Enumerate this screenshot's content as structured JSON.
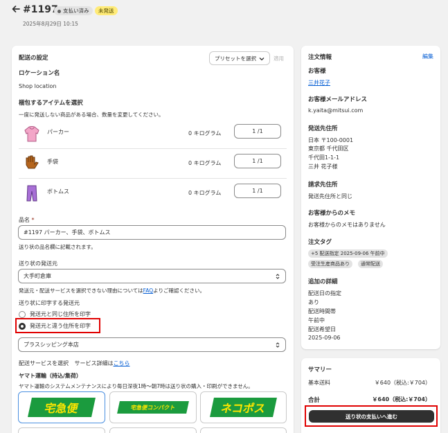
{
  "header": {
    "back_icon": "arrow-left-icon",
    "order_number": "#1197",
    "payment_badge": "支払い済み",
    "fulfillment_badge": "未発送",
    "date": "2025年8月29日 10:15"
  },
  "shipping": {
    "title": "配送の設定",
    "preset_label": "プリセットを選択",
    "apply_label": "適用",
    "location_title": "ロケーション名",
    "location_value": "Shop location",
    "items_title": "梱包するアイテムを選択",
    "items_hint": "一度に発送しない商品がある場合、数量を変更してください。",
    "items": [
      {
        "name": "パーカー",
        "weight": "0 キログラム",
        "qty": "1 /1",
        "icon": "hoodie-icon"
      },
      {
        "name": "手袋",
        "weight": "0 キログラム",
        "qty": "1 /1",
        "icon": "glove-icon"
      },
      {
        "name": "ボトムス",
        "weight": "0 キログラム",
        "qty": "1 /1",
        "icon": "pants-icon"
      }
    ],
    "product_name_label": "品名",
    "product_name_required": "*",
    "product_name_value": "#1197 パーカー、手袋、ボトムス",
    "product_name_help": "送り状の品名欄に記載されます。",
    "origin_label": "送り状の発送元",
    "origin_value": "大手町倉庫",
    "origin_help_prefix": "発送元・配送サービスを選択できない理由については",
    "origin_help_link": "FAQ",
    "origin_help_suffix": "よりご確認ください。",
    "print_origin_label": "送り状に印字する発送元",
    "radio_same": "発送元と同じ住所を印字",
    "radio_different": "発送元と違う住所を印字",
    "print_origin_value": "プラスシッピング本店",
    "service_label": "配送サービスを選択",
    "service_detail_prefix": "サービス詳細は",
    "service_detail_link": "こちら",
    "carrier_name": "ヤマト運輸（持込/集荷）",
    "carrier_notice": "ヤマト運輸のシステムメンテナンスにより毎日深夜1時〜朝7時は送り状の購入・印刷ができません。",
    "carriers": [
      "宅急便",
      "宅急便コンパクト",
      "ネコポス"
    ]
  },
  "order_info": {
    "title": "注文情報",
    "edit_label": "編集",
    "customer_label": "お客様",
    "customer_name": "三井花子",
    "email_label": "お客様メールアドレス",
    "email_value": "k.yaita@mitsui.com",
    "ship_to_label": "発送先住所",
    "ship_to_lines": [
      "日本 〒100-0001",
      "東京都 千代田区",
      "千代田1-1-1",
      "三井 花子様"
    ],
    "billing_label": "請求先住所",
    "billing_value": "発送先住所と同じ",
    "memo_label": "お客様からのメモ",
    "memo_value": "お客様からのメモはありません",
    "tags_label": "注文タグ",
    "tags": [
      "+5 配送指定 2025-09-06 午前中",
      "受注生産商品あり",
      "通常配送"
    ],
    "details_label": "追加の詳細",
    "details_lines": [
      "配送日の指定",
      "あり",
      "配送時間帯",
      "午前中",
      "配送希望日",
      "2025-09-06"
    ]
  },
  "summary": {
    "title": "サマリー",
    "base_fee_label": "基本送料",
    "base_fee_value": "￥640（税込:￥704）",
    "total_label": "合計",
    "total_value": "￥640（税込:￥704）",
    "proceed_button": "送り状の支払いへ進む"
  },
  "colors": {
    "accent_link": "#005bd3",
    "paid_badge": "#e3e3e3",
    "unfulfilled_badge": "#ffeb78",
    "highlight": "#e00000",
    "button": "#303030"
  }
}
